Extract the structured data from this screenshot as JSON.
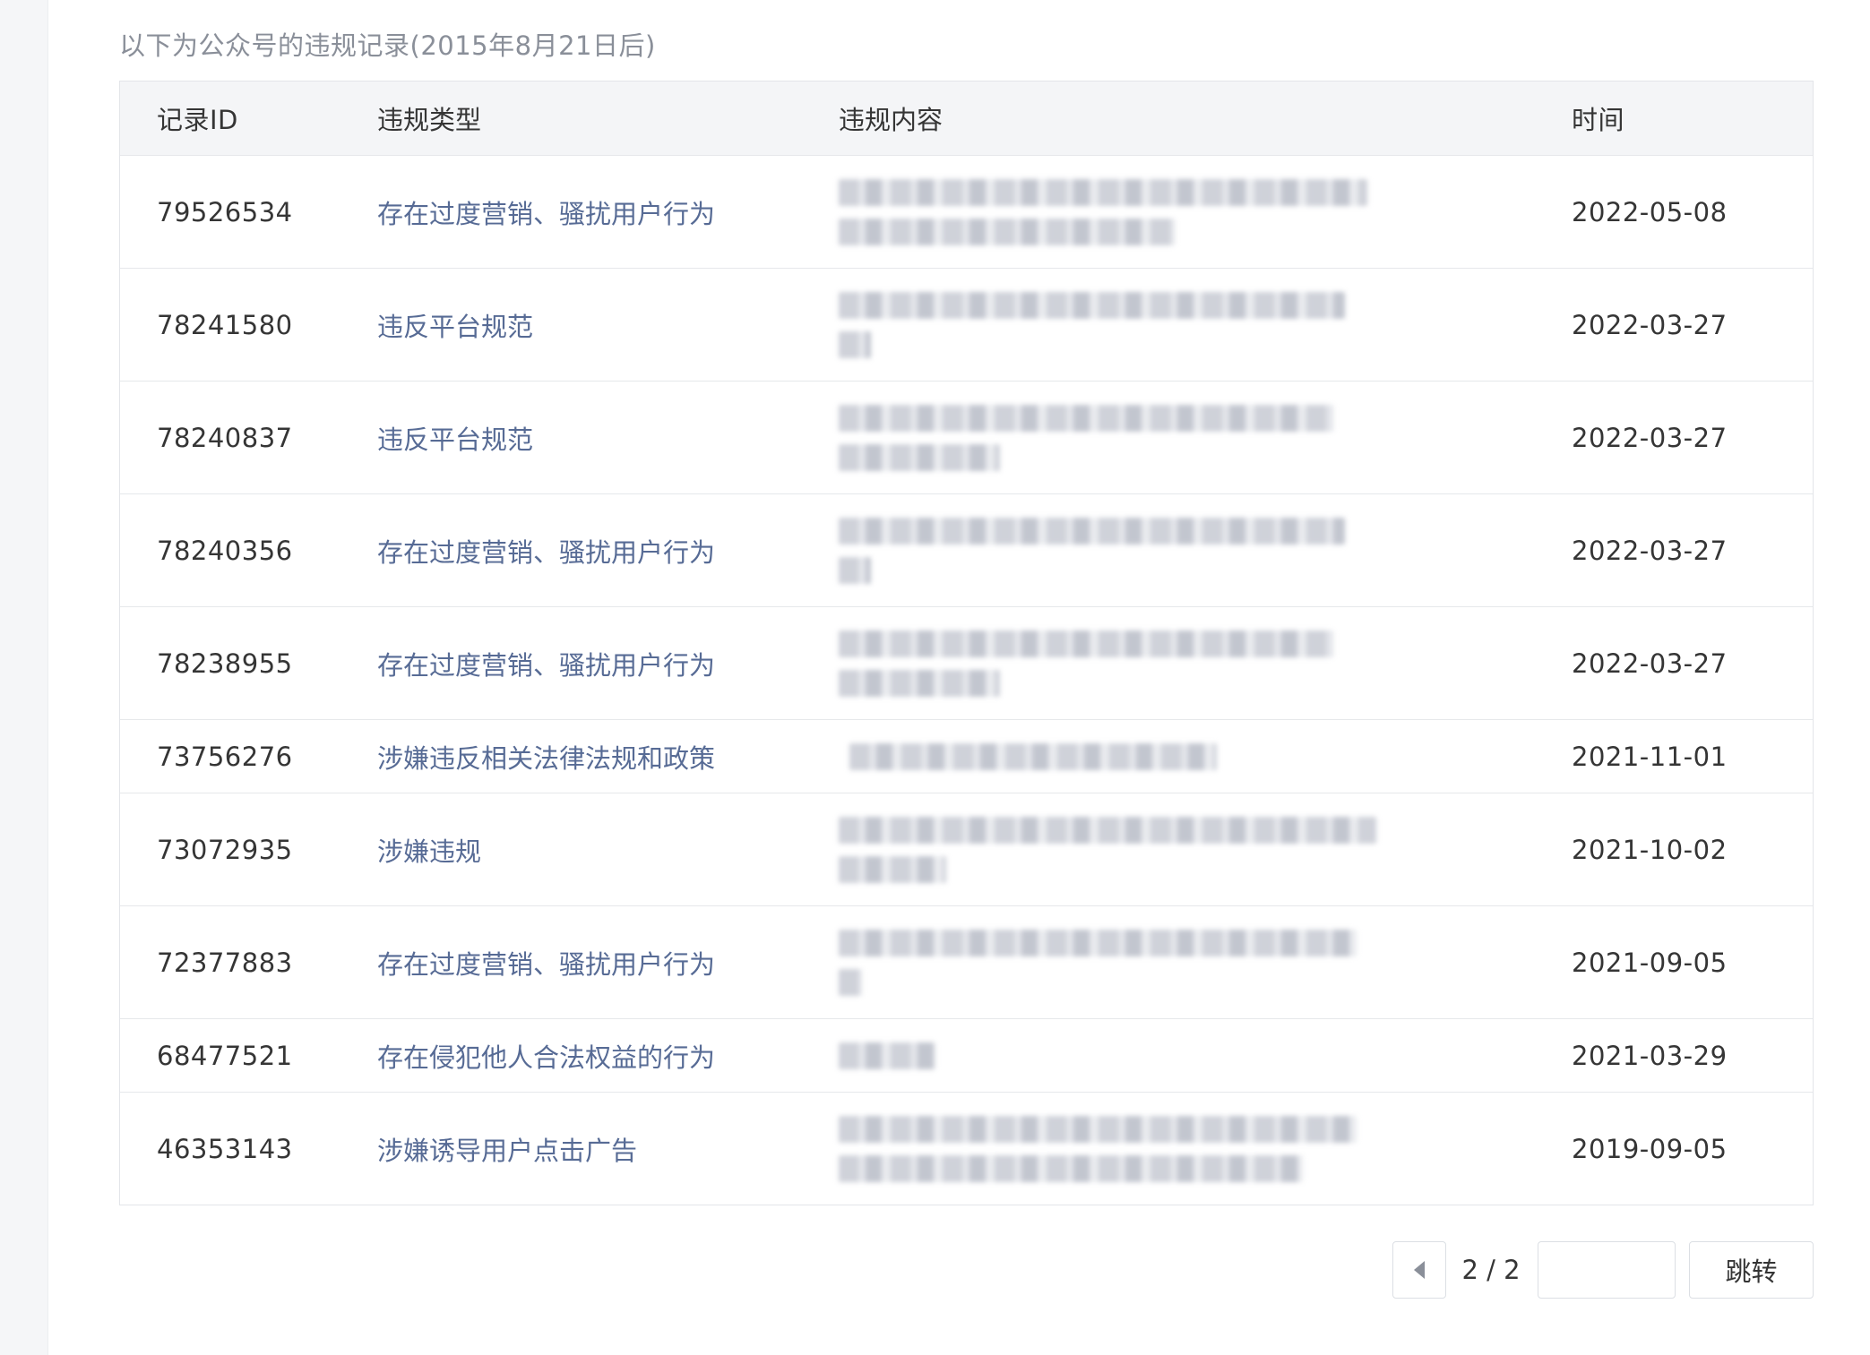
{
  "notice": "以下为公众号的违规记录(2015年8月21日后)",
  "table": {
    "headers": {
      "id": "记录ID",
      "type": "违规类型",
      "content": "违规内容",
      "time": "时间"
    },
    "rows": [
      {
        "id": "79526534",
        "type": "存在过度营销、骚扰用户行为",
        "time": "2022-05-08"
      },
      {
        "id": "78241580",
        "type": "违反平台规范",
        "time": "2022-03-27"
      },
      {
        "id": "78240837",
        "type": "违反平台规范",
        "time": "2022-03-27"
      },
      {
        "id": "78240356",
        "type": "存在过度营销、骚扰用户行为",
        "time": "2022-03-27"
      },
      {
        "id": "78238955",
        "type": "存在过度营销、骚扰用户行为",
        "time": "2022-03-27"
      },
      {
        "id": "73756276",
        "type": "涉嫌违反相关法律法规和政策",
        "time": "2021-11-01"
      },
      {
        "id": "73072935",
        "type": "涉嫌违规",
        "time": "2021-10-02"
      },
      {
        "id": "72377883",
        "type": "存在过度营销、骚扰用户行为",
        "time": "2021-09-05"
      },
      {
        "id": "68477521",
        "type": "存在侵犯他人合法权益的行为",
        "time": "2021-03-29"
      },
      {
        "id": "46353143",
        "type": "涉嫌诱导用户点击广告",
        "time": "2019-09-05"
      }
    ]
  },
  "pagination": {
    "page_info": "2 / 2",
    "jump_input_value": "",
    "jump_label": "跳转"
  },
  "colors": {
    "link": "#576b95",
    "text": "#353535",
    "muted": "#8a8f99",
    "header_bg": "#f4f5f7",
    "border": "#e3e5e9"
  }
}
